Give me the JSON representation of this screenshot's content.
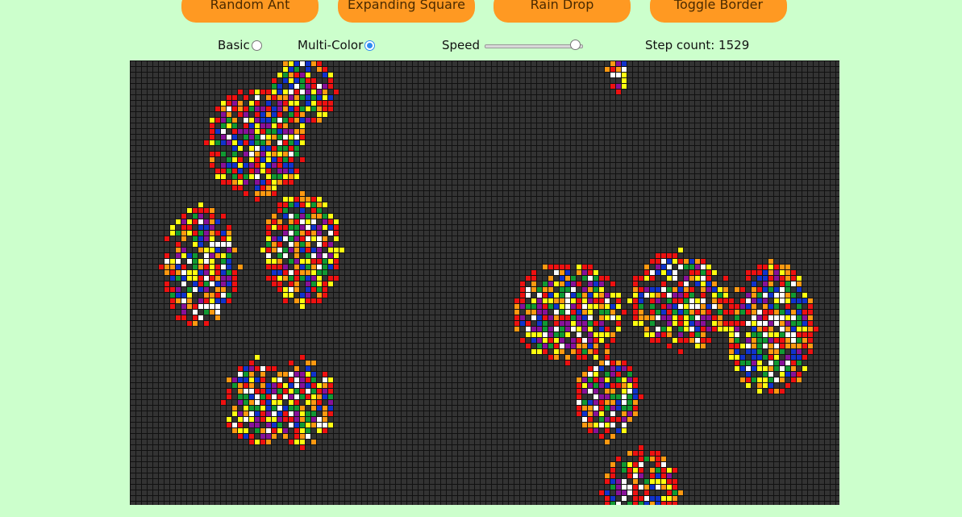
{
  "toolbar": {
    "buttons": [
      {
        "label": "Random Ant"
      },
      {
        "label": "Expanding Square"
      },
      {
        "label": "Rain Drop"
      },
      {
        "label": "Toggle Border"
      }
    ]
  },
  "controls": {
    "basic_label": "Basic",
    "multicolor_label": "Multi-Color",
    "selected_mode": "Multi-Color",
    "speed_label": "Speed",
    "speed_value": 0.97,
    "step_text": "Step count: 1529"
  },
  "colors": {
    "page_bg": "#ccffcc",
    "button": "#ff9922",
    "grid_bg": "#333333",
    "grid_line": "#111111",
    "palette": [
      "#ee1111",
      "#ff9911",
      "#ffff11",
      "#119933",
      "#1133cc",
      "#881199",
      "#ffffff"
    ]
  }
}
